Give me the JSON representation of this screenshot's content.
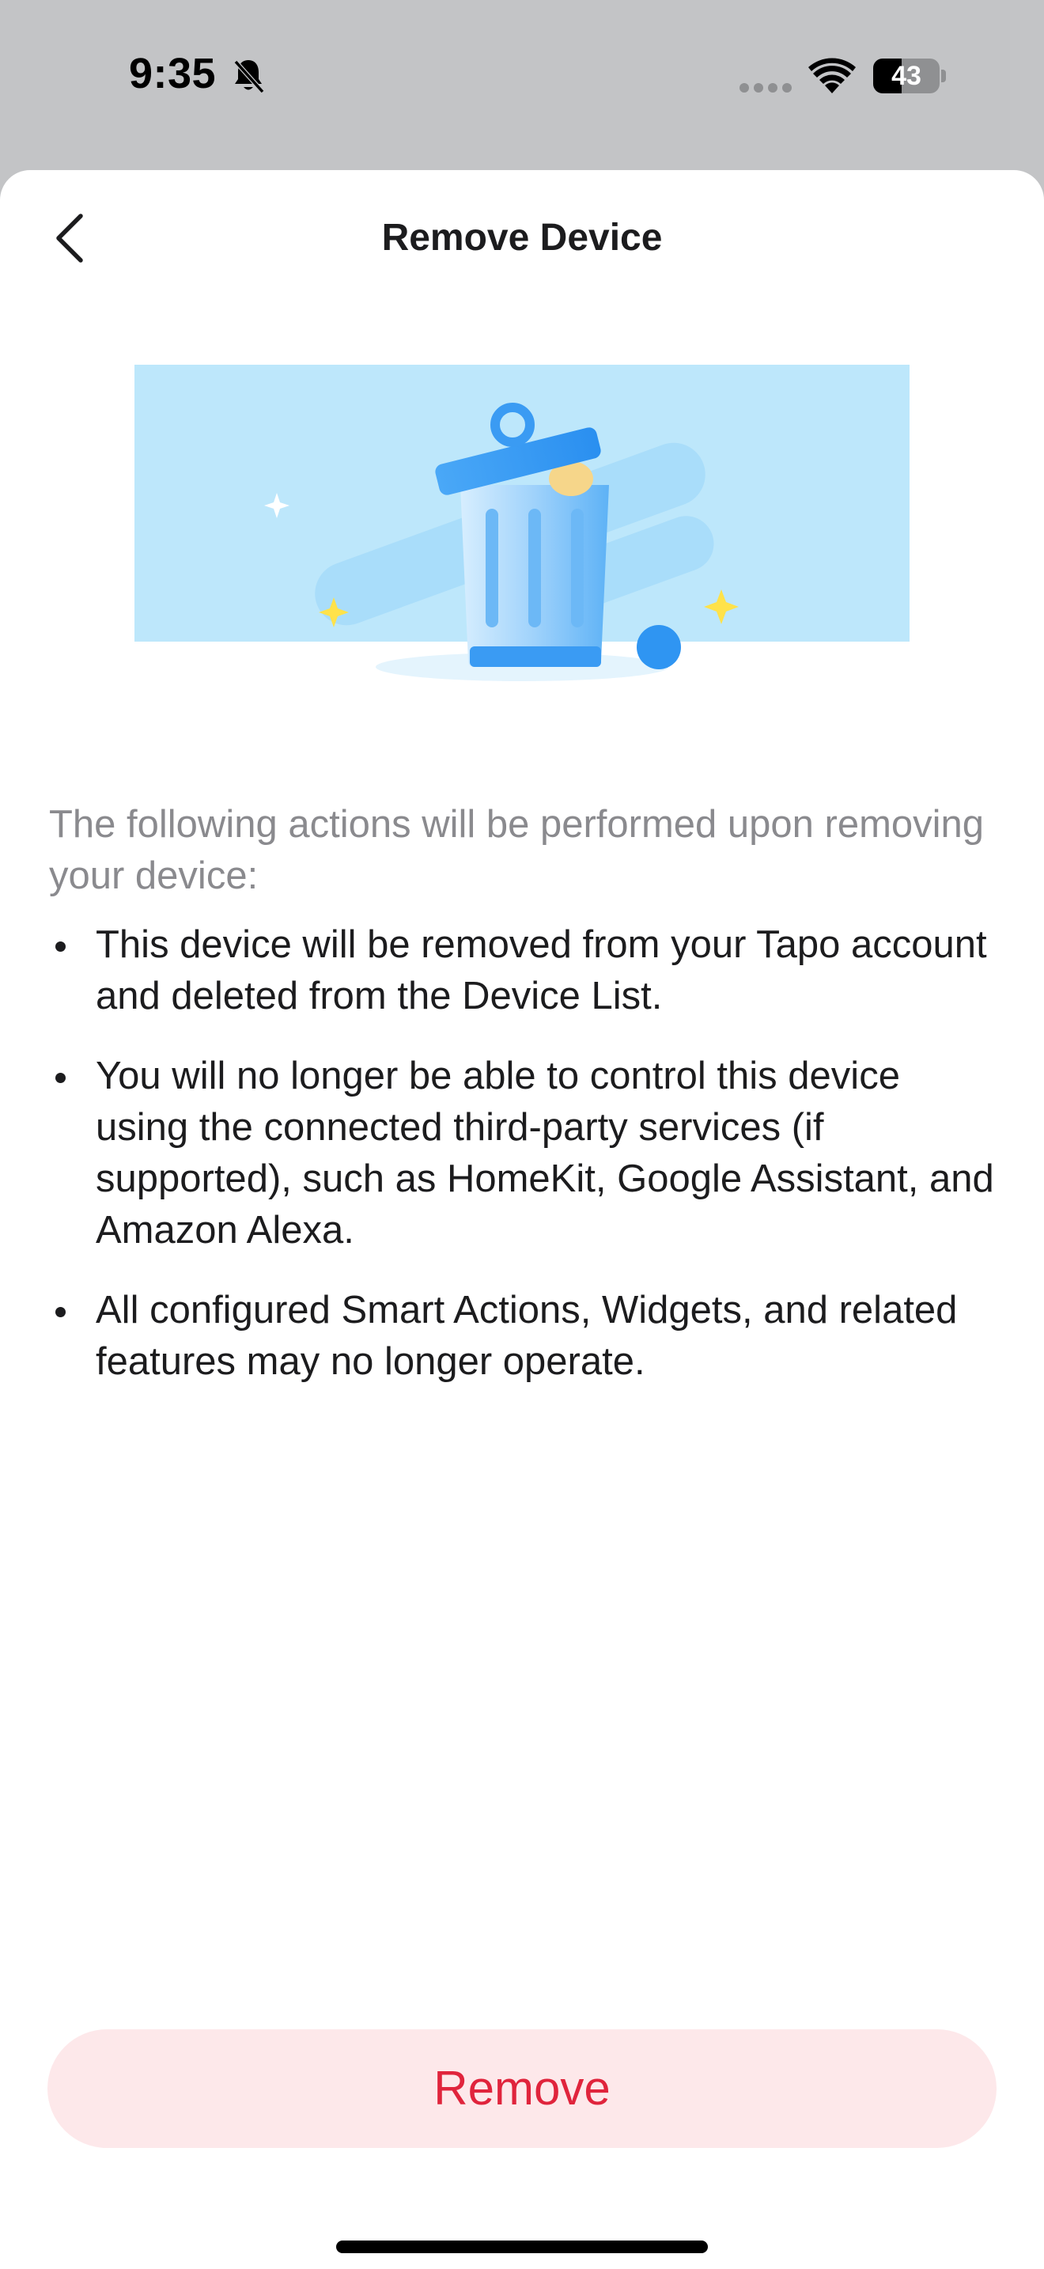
{
  "status_bar": {
    "time": "9:35",
    "battery_level": "43",
    "battery_fraction": 0.43,
    "icons": [
      "bell-slash-icon",
      "cellular-icon",
      "wifi-icon",
      "battery-icon"
    ]
  },
  "header": {
    "title": "Remove Device",
    "back_icon": "chevron-left-icon"
  },
  "illustration": {
    "icon": "trash-can-illustration",
    "colors": {
      "background": "#bde7fb",
      "can_blue": "#3b9cf3",
      "accent_yellow": "#ffe24a"
    }
  },
  "content": {
    "intro": "The following actions will be performed upon removing your device:",
    "bullets": [
      {
        "text": "This device will be removed from your Tapo account and deleted from the Device List."
      },
      {
        "text": "You will no longer be able to control this device using the connected third-party services (if supported), such as HomeKit, Google Assistant, and Amazon Alexa."
      },
      {
        "text": "All configured Smart Actions, Widgets, and related features may no longer operate."
      }
    ]
  },
  "actions": {
    "remove_label": "Remove"
  },
  "colors": {
    "accent_red": "#e0243c",
    "button_bg": "#fde8ea",
    "text_primary": "#1c1c1e",
    "text_secondary": "#8a8a8e"
  }
}
